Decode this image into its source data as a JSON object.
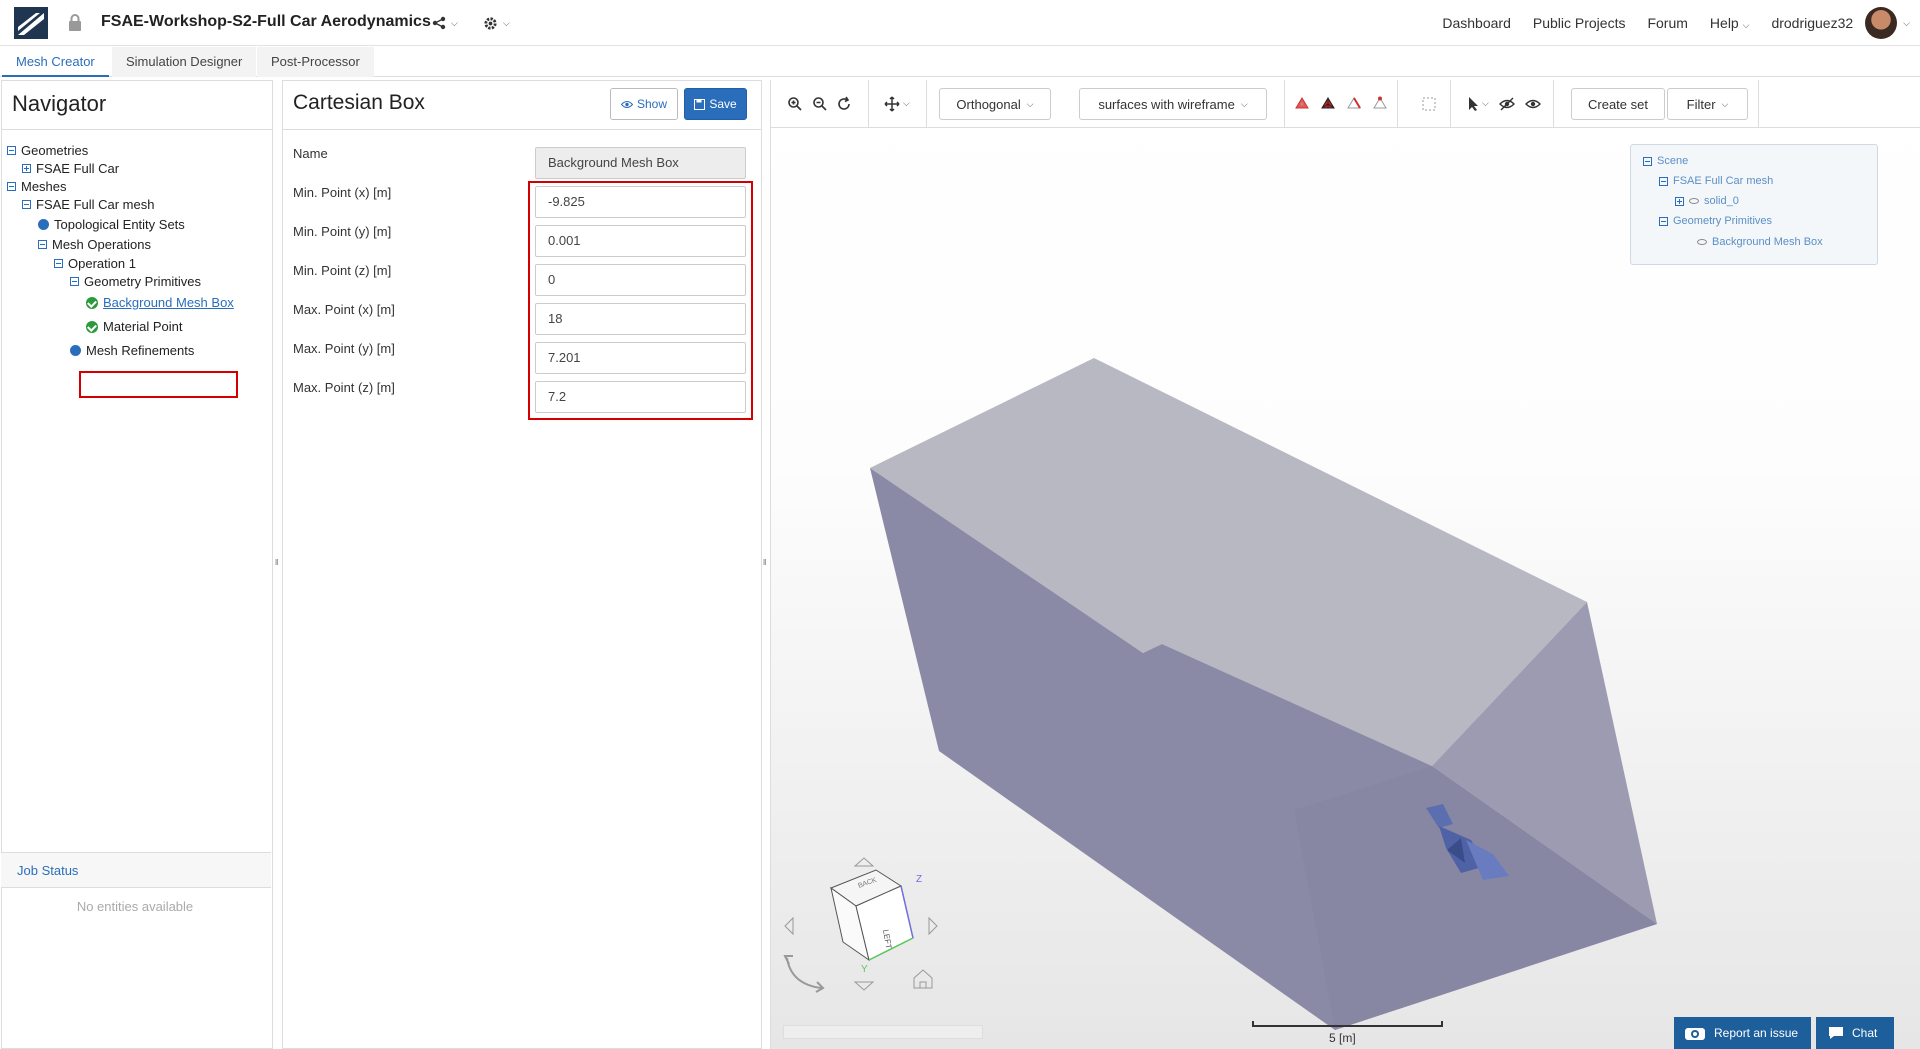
{
  "header": {
    "project_title": "FSAE-Workshop-S2-Full Car Aerodynamics",
    "nav_links": [
      "Dashboard",
      "Public Projects",
      "Forum",
      "Help"
    ],
    "username": "drodriguez32"
  },
  "tabs": [
    {
      "label": "Mesh Creator",
      "active": true
    },
    {
      "label": "Simulation Designer",
      "active": false
    },
    {
      "label": "Post-Processor",
      "active": false
    }
  ],
  "navigator": {
    "title": "Navigator",
    "tree": {
      "geometries": "Geometries",
      "fsae_full_car": "FSAE Full Car",
      "meshes": "Meshes",
      "fsae_full_car_mesh": "FSAE Full Car mesh",
      "topological_entity_sets": "Topological Entity Sets",
      "mesh_operations": "Mesh Operations",
      "operation_1": "Operation 1",
      "geometry_primitives": "Geometry Primitives",
      "background_mesh_box": "Background Mesh Box",
      "material_point": "Material Point",
      "mesh_refinements": "Mesh Refinements"
    },
    "job_status": {
      "title": "Job Status",
      "empty": "No entities available"
    }
  },
  "cartesian_box": {
    "title": "Cartesian Box",
    "show_label": "Show",
    "save_label": "Save",
    "fields": {
      "name": {
        "label": "Name",
        "value": "Background Mesh Box"
      },
      "min_x": {
        "label": "Min. Point (x) [m]",
        "value": "-9.825"
      },
      "min_y": {
        "label": "Min. Point (y) [m]",
        "value": "0.001"
      },
      "min_z": {
        "label": "Min. Point (z) [m]",
        "value": "0"
      },
      "max_x": {
        "label": "Max. Point (x) [m]",
        "value": "18"
      },
      "max_y": {
        "label": "Max. Point (y) [m]",
        "value": "7.201"
      },
      "max_z": {
        "label": "Max. Point (z) [m]",
        "value": "7.2"
      }
    }
  },
  "viewer": {
    "toolbar": {
      "projection": "Orthogonal",
      "render_mode": "surfaces with wireframe",
      "create_set": "Create set",
      "filter": "Filter"
    },
    "scene_tree": {
      "scene": "Scene",
      "mesh": "FSAE Full Car mesh",
      "solid": "solid_0",
      "primitives": "Geometry Primitives",
      "box": "Background Mesh Box"
    },
    "scale_label": "5 [m]",
    "cube_labels": {
      "front": "LEFT",
      "top": "BACK",
      "z": "Z",
      "y": "Y"
    }
  },
  "footer": {
    "report": "Report an issue",
    "chat": "Chat"
  },
  "colors": {
    "accent": "#2a6ebb",
    "highlight": "#d40000",
    "box_top": "#b9b9c3",
    "box_side": "#8a8aa8"
  }
}
